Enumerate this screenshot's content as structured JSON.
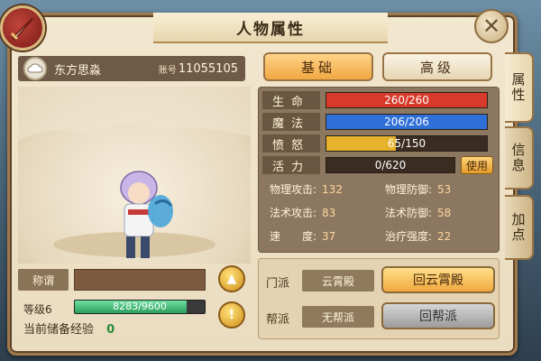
{
  "window": {
    "title": "人物属性"
  },
  "character": {
    "name": "东方思淼",
    "account_label": "账号",
    "account_id": "11055105",
    "title_label": "称谓",
    "title_value": "",
    "level_label": "等级6",
    "exp_progress": "8283/9600",
    "exp_fraction": 0.8628,
    "stored_exp_label": "当前储备经验",
    "stored_exp_value": "0"
  },
  "tabs": {
    "basic": "基础",
    "advanced": "高级"
  },
  "bars": {
    "hp": {
      "label": "生命",
      "value": "260/260",
      "fraction": 1.0,
      "color": "#d73a2a"
    },
    "mp": {
      "label": "魔法",
      "value": "206/206",
      "fraction": 1.0,
      "color": "#2f6fd8"
    },
    "rage": {
      "label": "愤怒",
      "value": "65/150",
      "fraction": 0.4333,
      "color": "#e7b22c"
    },
    "vitality": {
      "label": "活力",
      "value": "0/620",
      "fraction": 0.0,
      "color": "#7a6a52"
    }
  },
  "use_button": "使用",
  "attributes": {
    "phys_atk": {
      "label": "物理攻击:",
      "value": "132"
    },
    "phys_def": {
      "label": "物理防御:",
      "value": "53"
    },
    "mag_atk": {
      "label": "法术攻击:",
      "value": "83"
    },
    "mag_def": {
      "label": "法术防御:",
      "value": "58"
    },
    "speed": {
      "label": "速　　度:",
      "value": "37"
    },
    "heal": {
      "label": "治疗强度:",
      "value": "22"
    }
  },
  "faction": {
    "sect_label": "门派",
    "sect_value": "云霄殿",
    "sect_button": "回云霄殿",
    "guild_label": "帮派",
    "guild_value": "无帮派",
    "guild_button": "回帮派"
  },
  "side_tabs": {
    "attributes": "属性",
    "info": "信息",
    "points": "加点"
  },
  "colors": {
    "accent": "#f0a742",
    "panel": "#eadcc0"
  }
}
